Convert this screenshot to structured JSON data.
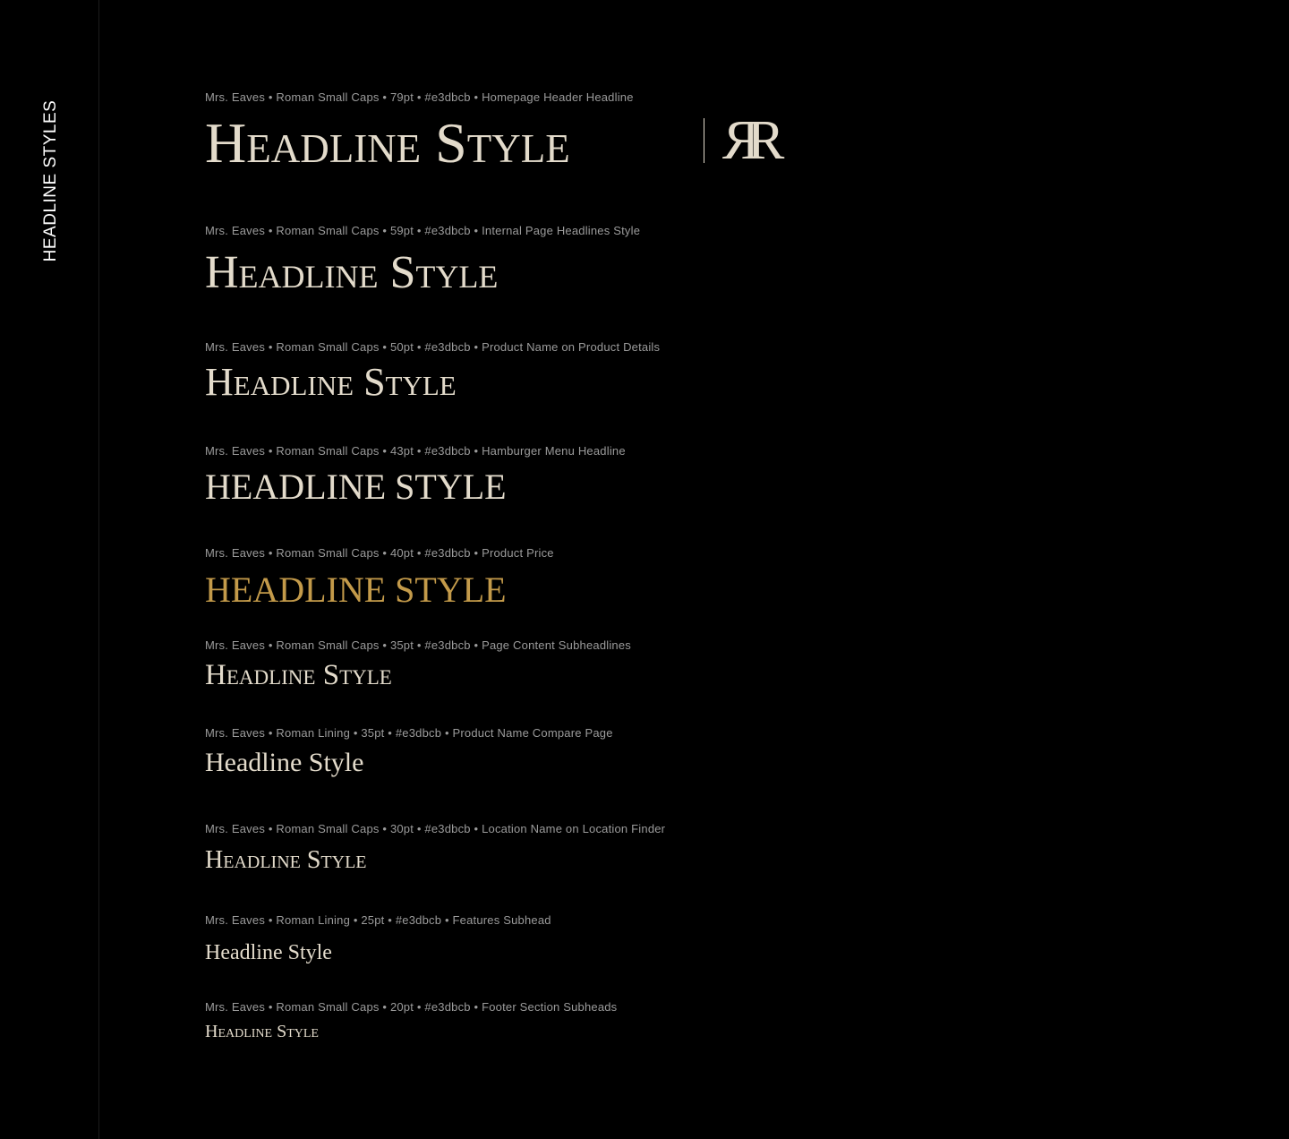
{
  "sidebar": {
    "title": "HEADLINE STYLES"
  },
  "colors": {
    "text": "#e3dbcb",
    "accent_gold": "#c39a4a",
    "meta": "#9b9b9b",
    "background": "#000000"
  },
  "specimens": [
    {
      "meta": "Mrs. Eaves • Roman Small Caps  • 79pt • #e3dbcb  • Homepage Header Headline",
      "sample": "Headline Style"
    },
    {
      "meta": "Mrs. Eaves • Roman Small Caps  • 59pt • #e3dbcb  • Internal Page Headlines Style",
      "sample": "Headline Style"
    },
    {
      "meta": "Mrs. Eaves • Roman Small Caps  • 50pt • #e3dbcb  • Product Name on Product Details",
      "sample": "Headline Style"
    },
    {
      "meta": "Mrs. Eaves • Roman Small Caps  • 43pt • #e3dbcb  • Hamburger Menu Headline",
      "sample": "HEADLINE STYLE"
    },
    {
      "meta": "Mrs. Eaves • Roman Small Caps  • 40pt • #e3dbcb  • Product Price",
      "sample": "HEADLINE STYLE"
    },
    {
      "meta": "Mrs. Eaves • Roman Small Caps  • 35pt • #e3dbcb  • Page Content Subheadlines",
      "sample": "Headline Style"
    },
    {
      "meta": "Mrs. Eaves • Roman Lining  • 35pt • #e3dbcb  • Product Name Compare Page",
      "sample": "Headline Style"
    },
    {
      "meta": "Mrs. Eaves • Roman Small Caps  • 30pt • #e3dbcb  • Location Name on Location Finder",
      "sample": "Headline Style"
    },
    {
      "meta": "Mrs. Eaves • Roman Lining  • 25pt • #e3dbcb  • Features Subhead",
      "sample": "Headline Style"
    },
    {
      "meta": "Mrs. Eaves • Roman Small Caps  • 20pt • #e3dbcb  • Footer Section Subheads",
      "sample": "Headline Style"
    }
  ],
  "logo": {
    "icon": "rr-monogram-logo",
    "letter": "R"
  }
}
